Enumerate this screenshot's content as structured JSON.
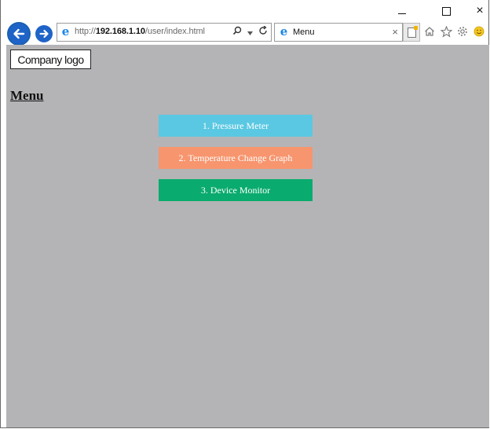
{
  "browser": {
    "url_scheme": "http://",
    "url_host": "192.168.1.10",
    "url_path": "/user/index.html",
    "search_icon": "search-icon",
    "dropdown_icon": "dropdown-icon",
    "refresh_icon": "refresh-icon",
    "tab_title": "Menu",
    "tab_close": "×",
    "window_close": "×"
  },
  "page": {
    "logo_text": "Company logo",
    "menu_heading": "Menu",
    "buttons": [
      {
        "label": "1. Pressure Meter",
        "color": "#5ac8e2"
      },
      {
        "label": "2. Temperature Change Graph",
        "color": "#f7956e"
      },
      {
        "label": "3. Device Monitor",
        "color": "#0aab6e"
      }
    ],
    "background_color": "#b4b4b6"
  }
}
